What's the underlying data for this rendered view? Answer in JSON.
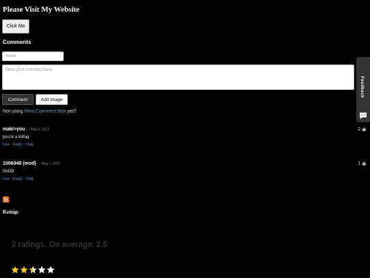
{
  "header": {
    "title": "Please Visit My Website",
    "button_label": "Click Me"
  },
  "comments_section": {
    "heading": "Comments",
    "name_placeholder": "Name",
    "comment_placeholder": "Enter your comment here",
    "comment_button": "Comment",
    "add_image_button": "Add Image",
    "promo_prefix": "Not using",
    "promo_link": "Html Comment Box",
    "promo_suffix": "yet?",
    "comments": [
      {
        "author": "maki>you",
        "date": "May 3, 2017",
        "text": "you're a lolifag",
        "votes": "2",
        "actions": [
          "Like",
          "Reply",
          "Flag"
        ]
      },
      {
        "author": "1006948 (mod)",
        "date": "May 1, 2017",
        "text": "NoOB",
        "votes": "1",
        "actions": [
          "Like",
          "Reply",
          "Flag"
        ]
      }
    ]
  },
  "ratings": {
    "heading": "Ratings",
    "summary": "2 ratings. On average, 2.5",
    "average": 2.5,
    "max": 5
  },
  "feedback_tab": {
    "label": "Feedback"
  },
  "colors": {
    "background": "#000000",
    "link": "#5b9bd5",
    "star_filled": "#f5c518",
    "star_empty": "#ffffff",
    "rss": "#e8611a"
  },
  "icons": [
    "rss-icon",
    "thumbs-up-icon",
    "star-icon",
    "feedback-icon"
  ]
}
